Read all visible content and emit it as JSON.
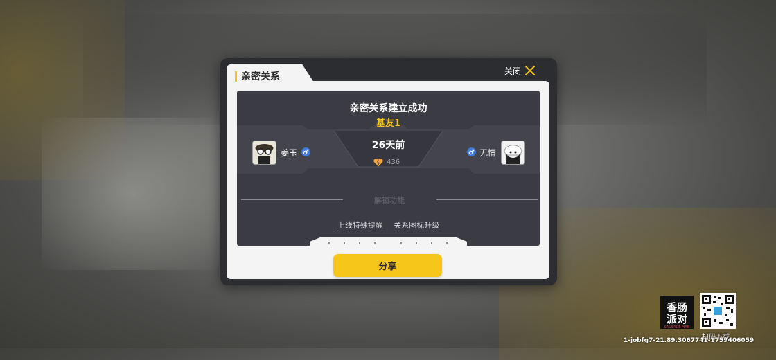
{
  "dialog": {
    "title": "亲密关系",
    "close_label": "关闭",
    "headline": "亲密关系建立成功",
    "relation_name": "基友1",
    "days": "26天前",
    "intimacy_value": "436",
    "unlock_title": "解锁功能",
    "features": [
      "上线特殊提醒",
      "关系图标升级"
    ],
    "share_label": "分享",
    "user_left": {
      "name": "姜玉",
      "gender_icon": "male-icon"
    },
    "user_right": {
      "name": "无情",
      "gender_icon": "male-icon"
    }
  },
  "watermark": {
    "logo_text": "香肠派对",
    "logo_sub": "SAUSAGE MAN",
    "scan_label": "扫码下载",
    "id_text": "1-jobfg7-21.89.3067741-1759406059"
  },
  "colors": {
    "accent_yellow": "#f6c719",
    "panel_bg": "#3b3c43",
    "dialog_frame": "#2c2d31",
    "male_blue": "#3f78d8"
  }
}
